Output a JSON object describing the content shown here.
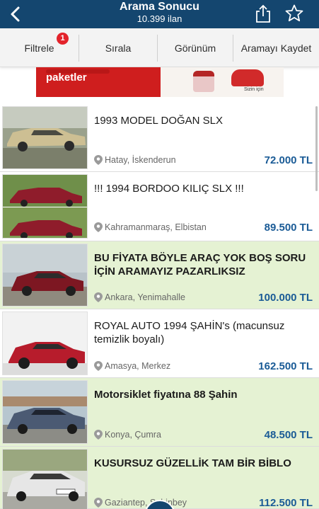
{
  "header": {
    "title": "Arama Sonucu",
    "subtitle": "10.399 ilan",
    "back_icon": "chevron-left-icon",
    "share_icon": "share-icon",
    "favorite_icon": "star-outline-icon",
    "bg_color": "#14466f"
  },
  "toolbar": {
    "filter_label": "Filtrele",
    "filter_badge": "1",
    "sort_label": "Sırala",
    "view_label": "Görünüm",
    "save_label": "Aramayı Kaydet"
  },
  "banner": {
    "text": "paketler",
    "small_text": "Sizin için"
  },
  "listings": [
    {
      "title": "1993 MODEL DOĞAN SLX",
      "location": "Hatay, İskenderun",
      "price": "72.000 TL",
      "highlighted": false,
      "car_color": "#c8b98e"
    },
    {
      "title": "!!! 1994 BORDOO KILIÇ SLX !!!",
      "location": "Kahramanmaraş, Elbistan",
      "price": "89.500 TL",
      "highlighted": false,
      "car_color": "#8f1c2b"
    },
    {
      "title": "BU FİYATA BÖYLE ARAÇ YOK BOŞ SORU İÇİN ARAMAYIZ PAZARLIKSIZ",
      "location": "Ankara, Yenimahalle",
      "price": "100.000 TL",
      "highlighted": true,
      "car_color": "#7d1722"
    },
    {
      "title": "ROYAL AUTO 1994 ŞAHİN's (macunsuz temizlik boyalı)",
      "location": "Amasya, Merkez",
      "price": "162.500 TL",
      "highlighted": false,
      "car_color": "#b71c2c"
    },
    {
      "title": "Motorsiklet fiyatına 88 Şahin",
      "location": "Konya, Çumra",
      "price": "48.500 TL",
      "highlighted": true,
      "car_color": "#4b5a73"
    },
    {
      "title": "KUSURSUZ GÜZELLİK TAM BİR BİBLO",
      "location": "Gaziantep, Şahinbey",
      "price": "112.500 TL",
      "highlighted": true,
      "car_color": "#e6e6e6"
    }
  ]
}
